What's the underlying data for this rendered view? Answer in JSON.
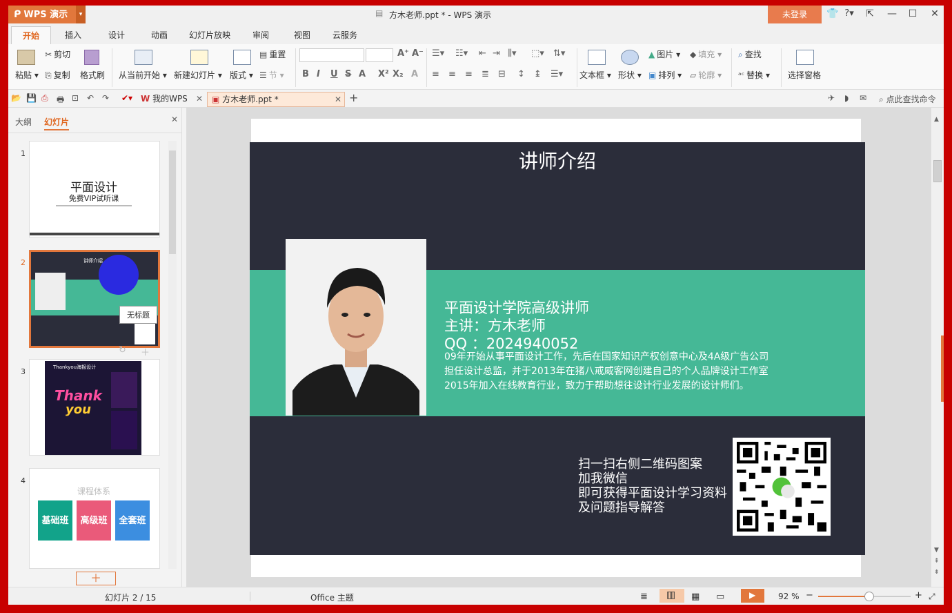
{
  "titlebar": {
    "app_name": "WPS 演示",
    "window_title": "方木老师.ppt * - WPS 演示",
    "login_label": "未登录",
    "help_label": "?"
  },
  "menu_tabs": [
    "开始",
    "插入",
    "设计",
    "动画",
    "幻灯片放映",
    "审阅",
    "视图",
    "云服务"
  ],
  "ribbon": {
    "paste": "粘贴",
    "cut": "剪切",
    "copy": "复制",
    "format_painter": "格式刷",
    "from_current": "从当前开始",
    "new_slide": "新建幻灯片",
    "layout": "版式",
    "reset": "重置",
    "section": "节",
    "textbox": "文本框",
    "shape": "形状",
    "picture": "图片",
    "fill": "填充",
    "arrange": "排列",
    "outline": "轮廓",
    "find": "查找",
    "replace": "替换",
    "select_pane": "选择窗格"
  },
  "qat": {
    "my_wps": "我的WPS",
    "doc_tab": "方木老师.ppt *",
    "search_cmd": "点此查找命令"
  },
  "left_pane": {
    "tab_outline": "大纲",
    "tab_slides": "幻灯片",
    "tooltip": "无标题",
    "slides": [
      {
        "num": "1",
        "title": "平面设计",
        "subtitle": "免费VIP试听课"
      },
      {
        "num": "2",
        "title": "讲师介绍"
      },
      {
        "num": "3",
        "title": "Thankyou海报设计"
      },
      {
        "num": "4",
        "title": "课程体系",
        "cards": [
          "基础班",
          "高级班",
          "全套班"
        ]
      }
    ]
  },
  "slide": {
    "title": "讲师介绍",
    "line1": "平面设计学院高级讲师",
    "line2": "主讲：方木老师",
    "line3": "QQ ：2024940052",
    "bio1": "09年开始从事平面设计工作，先后在国家知识产权创意中心及4A级广告公司",
    "bio2": "担任设计总监，并于2013年在猪八戒威客网创建自己的个人品牌设计工作室",
    "bio3": "2015年加入在线教育行业，致力于帮助想往设计行业发展的设计师们。",
    "qr1": "扫一扫右侧二维码图案",
    "qr2": "加我微信",
    "qr3": "即可获得平面设计学习资料",
    "qr4": "及问题指导解答"
  },
  "statusbar": {
    "slide_pos": "幻灯片 2 / 15",
    "theme": "Office 主题",
    "zoom": "92 %",
    "zoom_fraction": 0.55
  },
  "colors": {
    "accent": "#e2773c",
    "slide_dark": "#2b2d3a",
    "slide_green": "#45b896"
  }
}
